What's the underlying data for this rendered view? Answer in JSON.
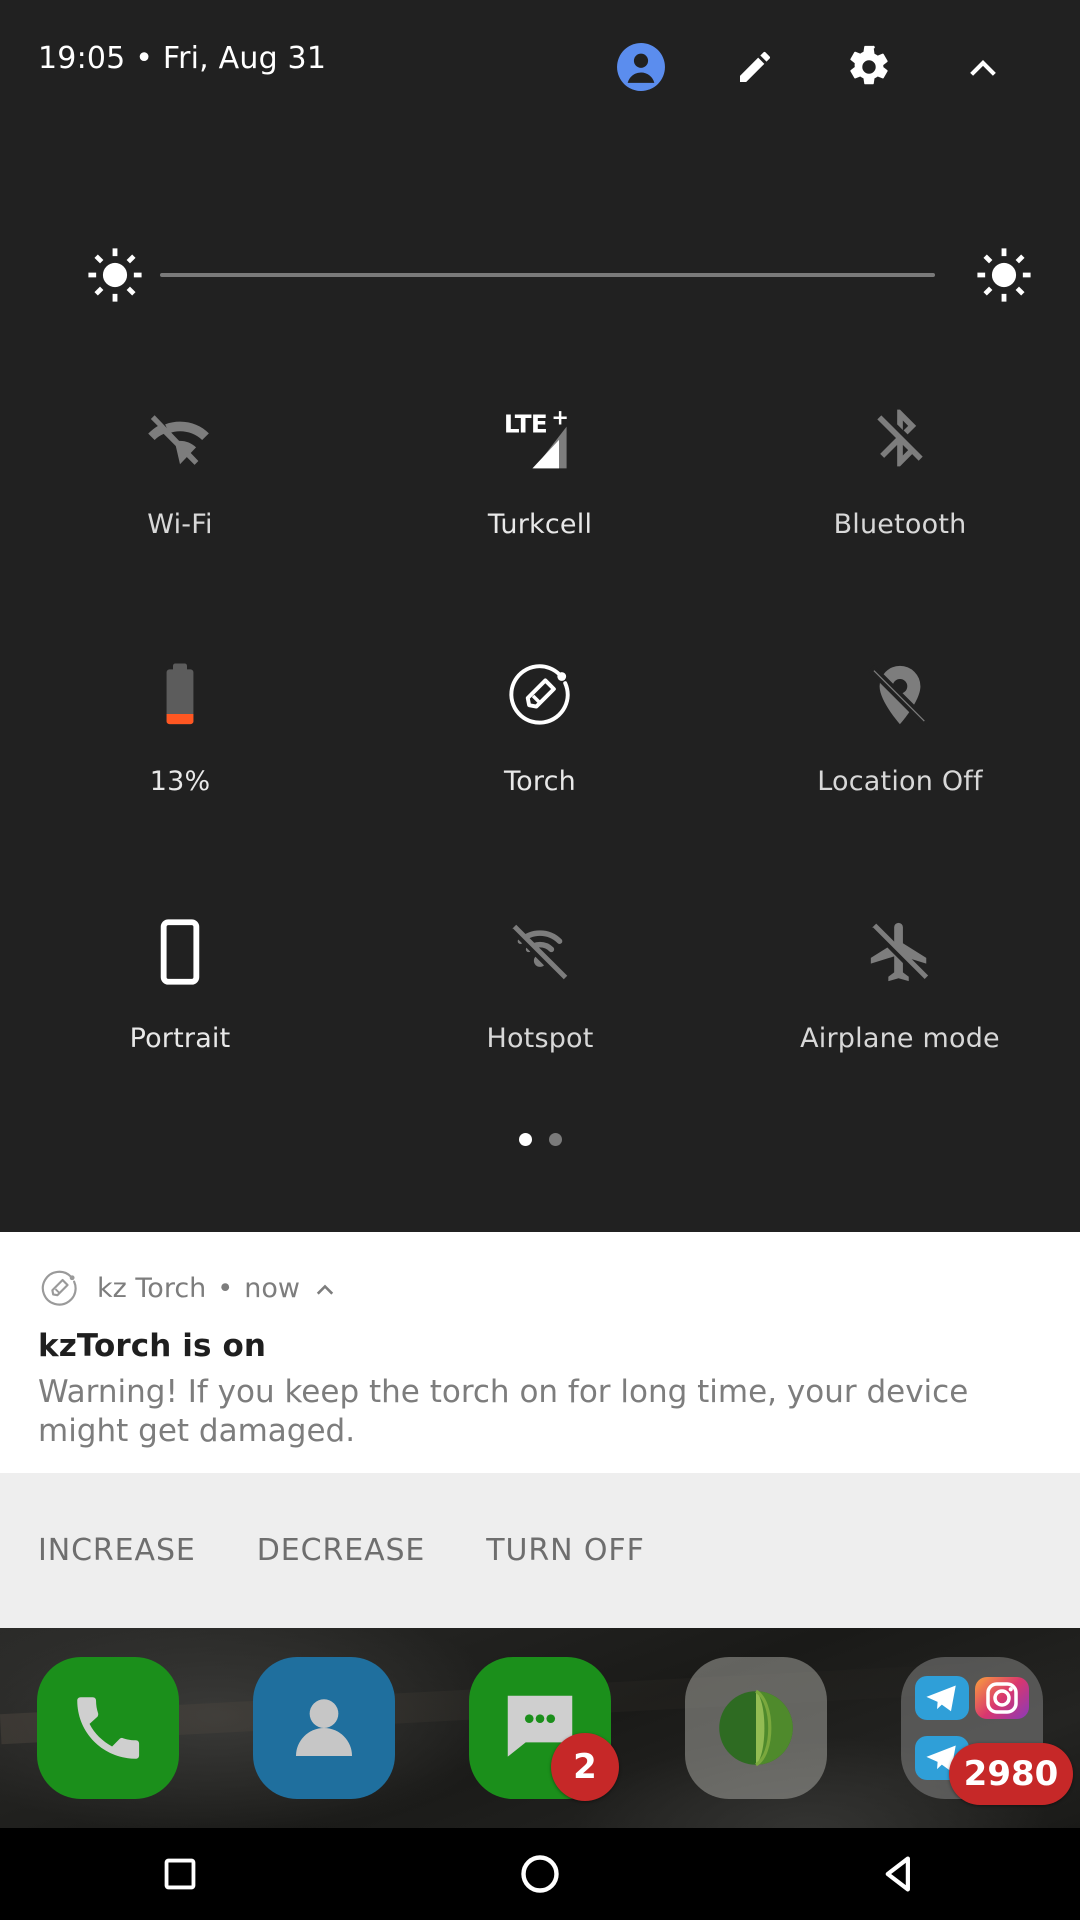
{
  "status_header": {
    "clock_and_date": "19:05 • Fri, Aug 31",
    "avatar_icon": "user-avatar-icon",
    "edit_icon": "pencil-edit-icon",
    "settings_icon": "gear-icon",
    "collapse_icon": "chevron-up-icon",
    "avatar_color": "#5b8dee"
  },
  "brightness": {
    "low_icon": "brightness-low-icon",
    "high_icon": "brightness-high-icon",
    "value_percent": 0,
    "track_color": "#7a7a7a"
  },
  "tiles": [
    [
      {
        "label": "Wi-Fi",
        "icon": "wifi-off-icon",
        "state": "off"
      },
      {
        "label": "Turkcell",
        "icon": "signal-lte-plus-icon",
        "state": "on",
        "network_type": "LTE+"
      },
      {
        "label": "Bluetooth",
        "icon": "bluetooth-off-icon",
        "state": "off"
      }
    ],
    [
      {
        "label": "13%",
        "icon": "battery-low-icon",
        "state": "off",
        "battery_percent": 13,
        "battery_color": "#ff5722"
      },
      {
        "label": "Torch",
        "icon": "torch-icon",
        "state": "on"
      },
      {
        "label": "Location Off",
        "icon": "location-off-icon",
        "state": "off"
      }
    ],
    [
      {
        "label": "Portrait",
        "icon": "portrait-lock-icon",
        "state": "on"
      },
      {
        "label": "Hotspot",
        "icon": "hotspot-off-icon",
        "state": "off"
      },
      {
        "label": "Airplane mode",
        "icon": "airplane-off-icon",
        "state": "off"
      }
    ]
  ],
  "page_dots": {
    "count": 2,
    "active_index": 0
  },
  "notification": {
    "app_icon": "torch-icon",
    "app_name": "kz Torch",
    "separator": "•",
    "time": "now",
    "expand_icon": "chevron-up-icon",
    "title": "kzTorch is on",
    "body": "Warning! If you keep the torch on for long time, your device might get damaged.",
    "actions": [
      {
        "label": "INCREASE"
      },
      {
        "label": "DECREASE"
      },
      {
        "label": "TURN OFF"
      }
    ]
  },
  "dock": [
    {
      "name": "phone",
      "icon": "phone-icon",
      "color": "#1b8f1b",
      "badge": null
    },
    {
      "name": "contacts",
      "icon": "contacts-icon",
      "color": "#1f6f9e",
      "badge": null
    },
    {
      "name": "messages",
      "icon": "messages-icon",
      "color": "#1b8f1b",
      "badge": "2"
    },
    {
      "name": "app",
      "icon": "green-ball-icon",
      "color": "#9a9a93",
      "badge": null
    },
    {
      "name": "folder",
      "icon": "folder-icon",
      "color": "#a0a0a0",
      "badge": "2980",
      "contents": [
        "telegram-icon",
        "instagram-icon",
        "telegram-icon"
      ]
    }
  ],
  "navbar": {
    "recents_icon": "square-recents-icon",
    "home_icon": "circle-home-icon",
    "back_icon": "triangle-back-icon"
  }
}
